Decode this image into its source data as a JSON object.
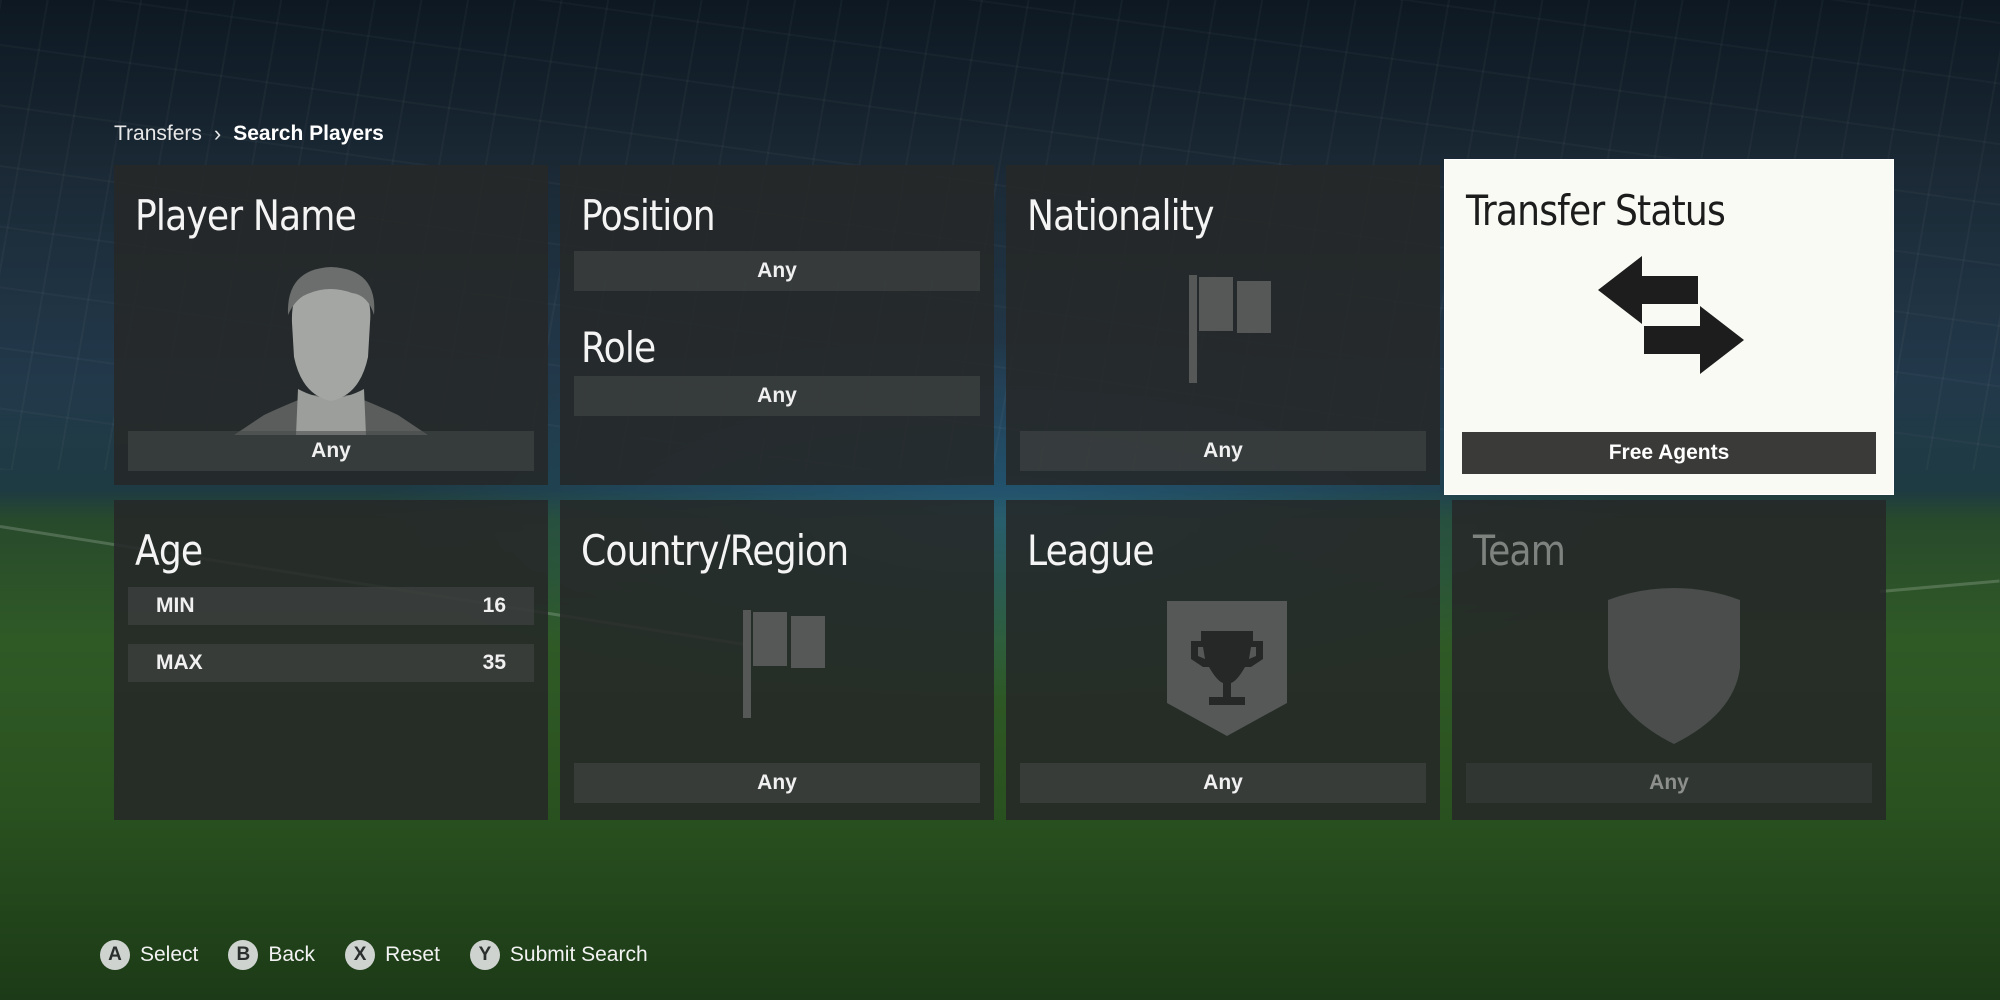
{
  "breadcrumb": {
    "root": "Transfers",
    "separator": "›",
    "current": "Search Players"
  },
  "tiles": {
    "player_name": {
      "title": "Player Name",
      "value": "Any"
    },
    "position": {
      "title": "Position",
      "value": "Any",
      "role_title": "Role",
      "role_value": "Any"
    },
    "nationality": {
      "title": "Nationality",
      "value": "Any"
    },
    "transfer_status": {
      "title": "Transfer Status",
      "value": "Free Agents",
      "selected": true
    },
    "age": {
      "title": "Age",
      "min_label": "MIN",
      "min_value": "16",
      "max_label": "MAX",
      "max_value": "35"
    },
    "country_region": {
      "title": "Country/Region",
      "value": "Any"
    },
    "league": {
      "title": "League",
      "value": "Any"
    },
    "team": {
      "title": "Team",
      "value": "Any",
      "disabled": true
    }
  },
  "icons": {
    "player_name": "player-silhouette-icon",
    "nationality": "flag-icon",
    "transfer_status": "swap-arrows-icon",
    "country_region": "flag-icon",
    "league": "trophy-shield-icon",
    "team": "club-crest-icon"
  },
  "footer": {
    "hints": [
      {
        "button": "A",
        "label": "Select"
      },
      {
        "button": "B",
        "label": "Back"
      },
      {
        "button": "X",
        "label": "Reset"
      },
      {
        "button": "Y",
        "label": "Submit Search"
      }
    ]
  },
  "colors": {
    "selected_tile_bg": "#fafaf4",
    "tile_bg": "#262828",
    "selected_value_bar": "#3a3a38"
  }
}
